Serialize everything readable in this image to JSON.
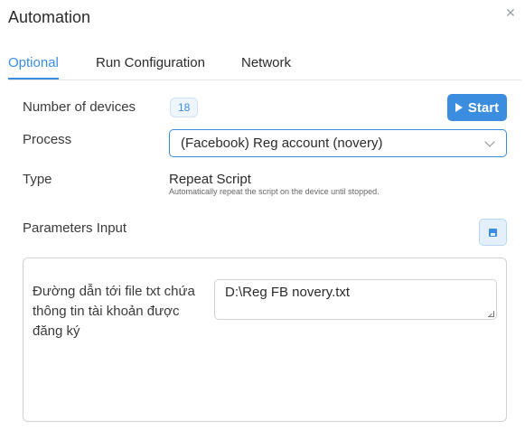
{
  "window": {
    "title": "Automation"
  },
  "tabs": [
    {
      "label": "Optional",
      "active": true
    },
    {
      "label": "Run Configuration",
      "active": false
    },
    {
      "label": "Network",
      "active": false
    }
  ],
  "form": {
    "devices_label": "Number of devices",
    "devices_count": "18",
    "start_label": "Start",
    "process_label": "Process",
    "process_value": "(Facebook) Reg account (novery)",
    "type_label": "Type",
    "type_value": "Repeat Script",
    "type_description": "Automatically repeat the script on the device until stopped.",
    "params_label": "Parameters Input"
  },
  "params": [
    {
      "label": "Đường dẫn tới file txt chứa thông tin tài khoản được đăng ký",
      "value": "D:\\Reg FB novery.txt"
    }
  ],
  "colors": {
    "accent": "#3b8de0"
  }
}
